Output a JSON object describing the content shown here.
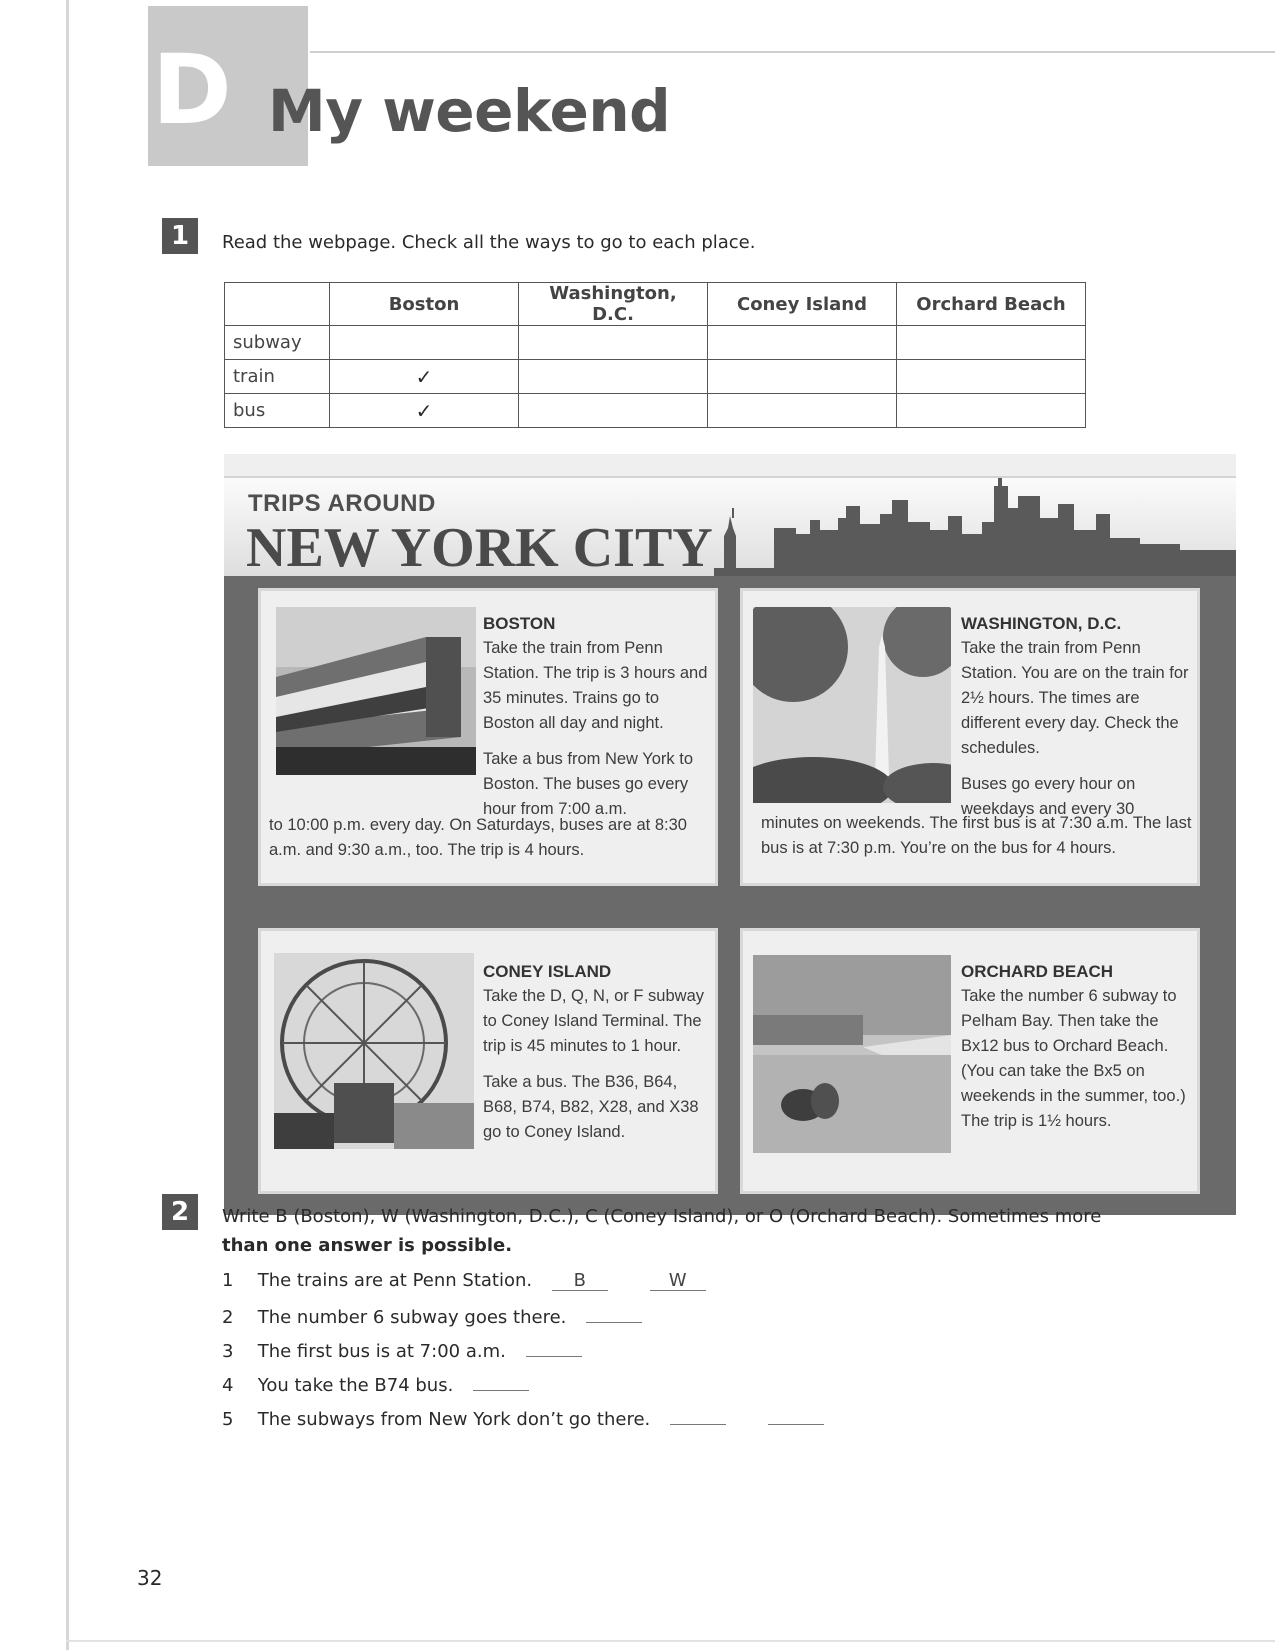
{
  "unit": {
    "letter": "D",
    "title": "My weekend"
  },
  "exercise1": {
    "number": "1",
    "instruction": "Read the webpage. Check all the ways to go to each place.",
    "table": {
      "columns": [
        "",
        "Boston",
        "Washington, D.C.",
        "Coney Island",
        "Orchard Beach"
      ],
      "rows": [
        {
          "label": "subway",
          "cells": [
            "",
            "",
            "",
            ""
          ]
        },
        {
          "label": "train",
          "cells": [
            "✓",
            "",
            "",
            ""
          ]
        },
        {
          "label": "bus",
          "cells": [
            "✓",
            "",
            "",
            ""
          ]
        }
      ]
    }
  },
  "webpage": {
    "subtitle": "TRIPS AROUND",
    "title": "NEW YORK CITY",
    "cards": {
      "boston": {
        "heading": "BOSTON",
        "p1": "Take the train from Penn Station. The trip is 3 hours and 35 minutes. Trains go to Boston all day and night.",
        "p2": "Take a bus from New York to Boston. The buses go every hour from 7:00 a.m.",
        "tail": "to 10:00 p.m. every day. On Saturdays, buses are at 8:30 a.m. and 9:30 a.m., too. The trip is 4 hours."
      },
      "washington": {
        "heading": "WASHINGTON, D.C.",
        "p1": "Take the train from Penn Station. You are on the train for 2½ hours. The times are different every day. Check the schedules.",
        "p2": "Buses go every hour on weekdays and every 30",
        "tail": "minutes on weekends. The first bus is at 7:30 a.m. The last bus is at 7:30 p.m. You’re on the bus for 4 hours."
      },
      "coney": {
        "heading": "CONEY ISLAND",
        "p1": "Take the D, Q, N, or F subway to Coney Island Terminal. The trip is 45 minutes to 1 hour.",
        "p2": "Take a bus. The B36, B64, B68, B74, B82, X28, and X38 go to Coney Island."
      },
      "orchard": {
        "heading": "ORCHARD BEACH",
        "p1": "Take the number 6 subway to Pelham Bay. Then take the Bx12 bus to Orchard Beach. (You can take the Bx5 on weekends in the summer, too.) The trip is 1½ hours."
      }
    }
  },
  "exercise2": {
    "number": "2",
    "instruction_line1": "Write B (Boston), W (Washington, D.C.), C (Coney Island), or O (Orchard Beach). Sometimes more",
    "instruction_line2": "than one answer is possible.",
    "items": [
      {
        "num": "1",
        "text": "The trains are at Penn Station.",
        "answers": [
          "B",
          "W"
        ]
      },
      {
        "num": "2",
        "text": "The number 6 subway goes there.",
        "answers": [
          ""
        ]
      },
      {
        "num": "3",
        "text": "The first bus is at 7:00 a.m.",
        "answers": [
          ""
        ]
      },
      {
        "num": "4",
        "text": "You take the B74 bus.",
        "answers": [
          ""
        ]
      },
      {
        "num": "5",
        "text": "The subways from New York don’t go there.",
        "answers": [
          "",
          ""
        ]
      }
    ]
  },
  "page_number": "32"
}
